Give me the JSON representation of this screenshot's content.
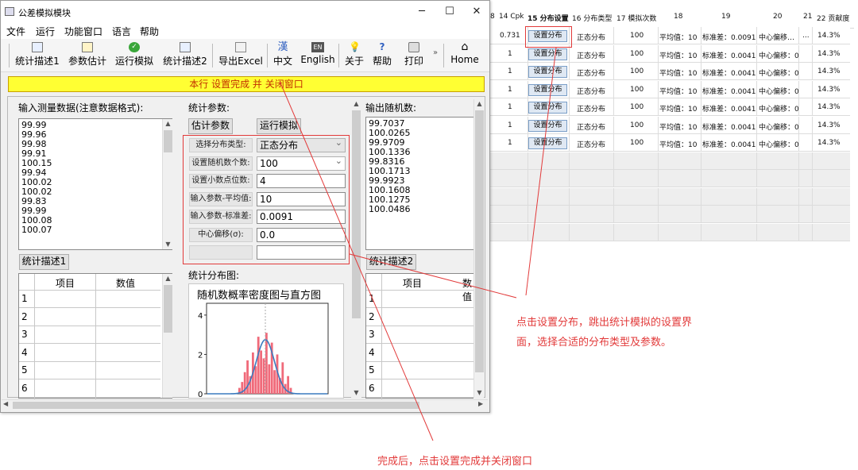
{
  "window": {
    "title": "公差模拟模块",
    "minimize": "─",
    "maximize": "☐",
    "close": "✕"
  },
  "menu": [
    "文件",
    "运行",
    "功能窗口",
    "语言",
    "帮助"
  ],
  "toolbar": [
    {
      "label": "统计描述1",
      "icon": "table-icon"
    },
    {
      "label": "参数估计",
      "icon": "edit-icon"
    },
    {
      "label": "运行模拟",
      "icon": "check-icon"
    },
    {
      "label": "统计描述2",
      "icon": "table-icon"
    },
    {
      "label": "导出Excel",
      "icon": "grid-icon"
    },
    {
      "label": "中文",
      "icon": "han-icon",
      "glyph": "漢"
    },
    {
      "label": "English",
      "icon": "en-icon",
      "glyph": "EN"
    },
    {
      "label": "关于",
      "icon": "lightbulb-icon"
    },
    {
      "label": "帮助",
      "icon": "help-icon"
    },
    {
      "label": "打印",
      "icon": "printer-icon"
    },
    {
      "label": "Home",
      "icon": "home-icon"
    }
  ],
  "toolbar_overflow": "»",
  "banner": "本行 设置完成 并 关闭窗口",
  "input_panel": {
    "label": "输入测量数据(注意数据格式):",
    "values": [
      "99.99",
      "99.96",
      "99.98",
      "99.91",
      "100.15",
      "99.94",
      "100.02",
      "100.02",
      "99.83",
      "99.99",
      "100.08",
      "100.07"
    ],
    "button": "统计描述1",
    "table_headers": [
      "项目",
      "数值"
    ],
    "row_numbers": [
      "1",
      "2",
      "3",
      "4",
      "5",
      "6"
    ]
  },
  "params_panel": {
    "label": "统计参数:",
    "estimate_button": "估计参数",
    "run_button": "运行模拟",
    "params": [
      {
        "label": "选择分布类型:",
        "value": "正态分布",
        "dropdown": true
      },
      {
        "label": "设置随机数个数:",
        "value": "100",
        "dropdown": true
      },
      {
        "label": "设置小数点位数:",
        "value": "4"
      },
      {
        "label": "输入参数-平均值:",
        "value": "10"
      },
      {
        "label": "输入参数-标准差:",
        "value": "0.0091"
      },
      {
        "label": "中心偏移(σ):",
        "value": "0.0"
      },
      {
        "label": "",
        "value": ""
      }
    ],
    "chart_section_label": "统计分布图:"
  },
  "output_panel": {
    "label": "输出随机数:",
    "values": [
      "99.7037",
      "100.0265",
      "99.9709",
      "100.1336",
      "99.8316",
      "100.1713",
      "99.9923",
      "100.1608",
      "100.1275",
      "100.0486"
    ],
    "button": "统计描述2",
    "table_headers": [
      "项目",
      "数值"
    ],
    "row_numbers": [
      "1",
      "2",
      "3",
      "4",
      "5",
      "6"
    ]
  },
  "chart_data": {
    "type": "bar",
    "title": "随机数概率密度图与直方图",
    "ylim": [
      0,
      4.6
    ],
    "yticks": [
      "0",
      "2",
      "4"
    ],
    "bars": [
      0.3,
      0.6,
      1.1,
      1.7,
      0.9,
      2.1,
      1.4,
      2.9,
      2.2,
      1.8,
      3.1,
      1.5,
      2.6,
      1.2,
      2.0,
      0.8,
      1.6,
      0.5,
      0.9,
      0.3
    ],
    "density_peak": 2.75,
    "colors": {
      "bars": "#f06a7a",
      "curve": "#3b7bbf"
    }
  },
  "sheet": {
    "headers": [
      "8",
      "14 Cpk",
      "15 分布设置",
      "16 分布类型",
      "17 模拟次数",
      "18",
      "19",
      "20",
      "21",
      "22 贡献度"
    ],
    "rows": [
      {
        "cpk": "0.731",
        "btn": "设置分布",
        "dist": "正态分布",
        "n": "100",
        "mean": "平均值：10",
        "sd": "标准差：0.0091",
        "shift": "中心偏移…",
        "c21": "...",
        "pct": "14.3%"
      },
      {
        "cpk": "1",
        "btn": "设置分布",
        "dist": "正态分布",
        "n": "100",
        "mean": "平均值：10",
        "sd": "标准差：0.0041",
        "shift": "中心偏移：0",
        "c21": "",
        "pct": "14.3%"
      },
      {
        "cpk": "1",
        "btn": "设置分布",
        "dist": "正态分布",
        "n": "100",
        "mean": "平均值：10",
        "sd": "标准差：0.0041",
        "shift": "中心偏移：0",
        "c21": "",
        "pct": "14.3%"
      },
      {
        "cpk": "1",
        "btn": "设置分布",
        "dist": "正态分布",
        "n": "100",
        "mean": "平均值：10",
        "sd": "标准差：0.0041",
        "shift": "中心偏移：0",
        "c21": "",
        "pct": "14.3%"
      },
      {
        "cpk": "1",
        "btn": "设置分布",
        "dist": "正态分布",
        "n": "100",
        "mean": "平均值：10",
        "sd": "标准差：0.0041",
        "shift": "中心偏移：0",
        "c21": "",
        "pct": "14.3%"
      },
      {
        "cpk": "1",
        "btn": "设置分布",
        "dist": "正态分布",
        "n": "100",
        "mean": "平均值：10",
        "sd": "标准差：0.0041",
        "shift": "中心偏移：0",
        "c21": "",
        "pct": "14.3%"
      },
      {
        "cpk": "1",
        "btn": "设置分布",
        "dist": "正态分布",
        "n": "100",
        "mean": "平均值：10",
        "sd": "标准差：0.0041",
        "shift": "中心偏移：0",
        "c21": "",
        "pct": "14.3%"
      }
    ]
  },
  "annotations": {
    "right_line1": "点击设置分布，跳出统计模拟的设置界",
    "right_line2": "面，选择合适的分布类型及参数。",
    "bottom": "完成后，点击设置完成并关闭窗口",
    "color": "#e23a3a"
  }
}
